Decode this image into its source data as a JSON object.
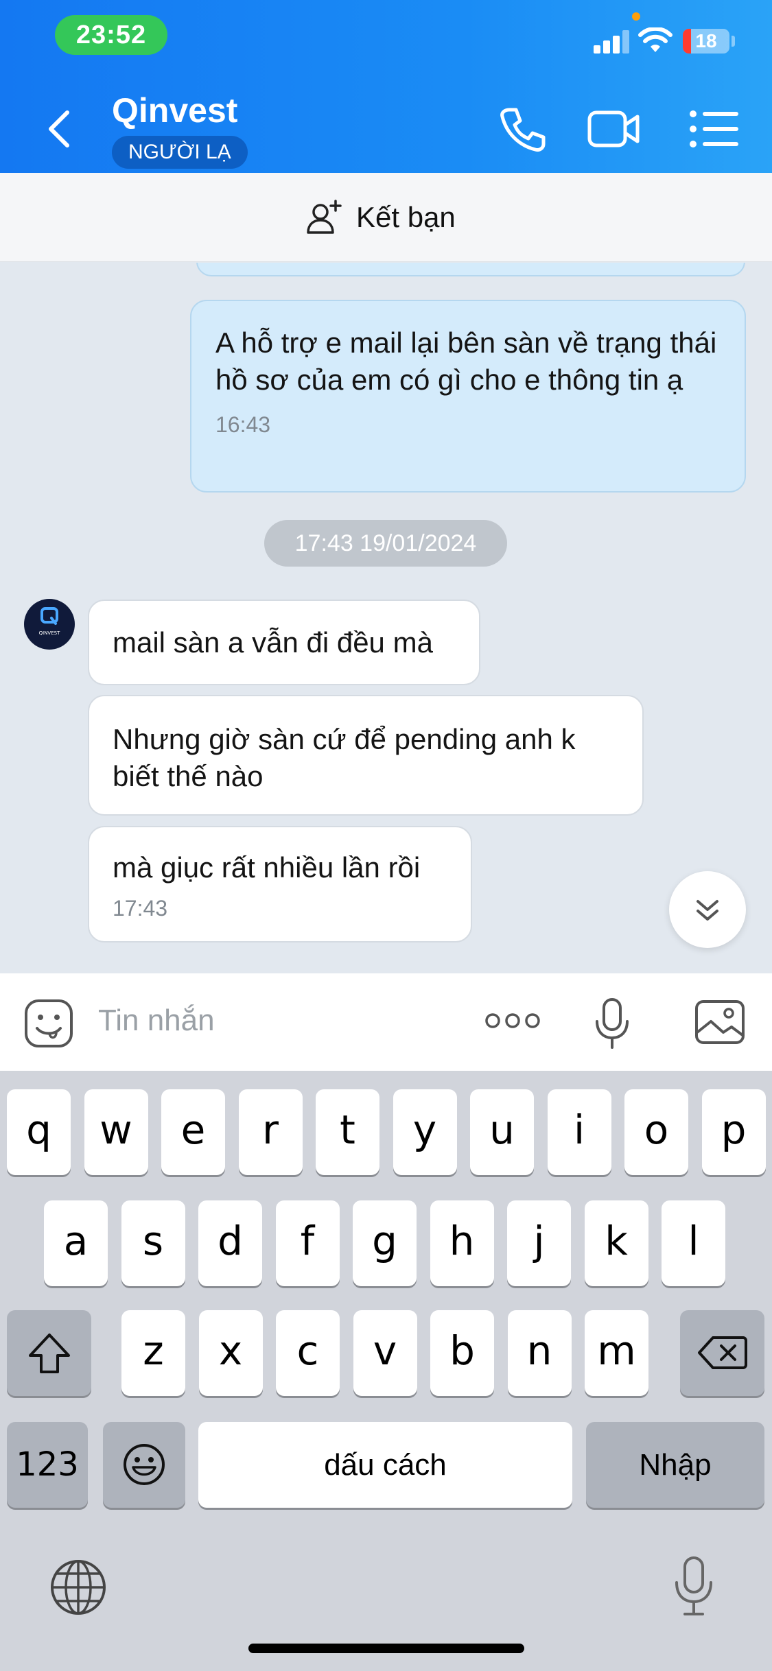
{
  "status_bar": {
    "time": "23:52",
    "battery": "18"
  },
  "header": {
    "title": "Qinvest",
    "badge": "NGƯỜI LẠ",
    "icons": [
      "back-icon",
      "phone-icon",
      "video-call-icon",
      "menu-list-icon"
    ]
  },
  "friend_bar": {
    "label": "Kết bạn"
  },
  "messages": [
    {
      "direction": "out",
      "text": "A hỗ trợ e mail lại bên sàn về trạng thái hồ sơ của em có gì cho e thông tin ạ",
      "time": "16:43"
    },
    {
      "direction": "in",
      "text": "mail sàn a vẫn đi đều mà"
    },
    {
      "direction": "in",
      "text": "Nhưng giờ sàn cứ để pending anh k biết thế nào"
    },
    {
      "direction": "in",
      "text": "mà giục rất nhiều lần rồi",
      "time": "17:43"
    }
  ],
  "date_separator": "17:43 19/01/2024",
  "avatar_text": "QINVEST",
  "input": {
    "placeholder": "Tin nhắn"
  },
  "keyboard": {
    "row1": [
      "q",
      "w",
      "e",
      "r",
      "t",
      "y",
      "u",
      "i",
      "o",
      "p"
    ],
    "row2": [
      "a",
      "s",
      "d",
      "f",
      "g",
      "h",
      "j",
      "k",
      "l"
    ],
    "row3": [
      "z",
      "x",
      "c",
      "v",
      "b",
      "n",
      "m"
    ],
    "numbers_key": "123",
    "space_key": "dấu cách",
    "return_key": "Nhập"
  },
  "colors": {
    "header_gradient_start": "#1478f2",
    "header_gradient_end": "#2aa3f7",
    "outgoing_bubble": "#d4ebfb",
    "incoming_bubble": "#ffffff",
    "chat_background": "#e2e8ef"
  }
}
